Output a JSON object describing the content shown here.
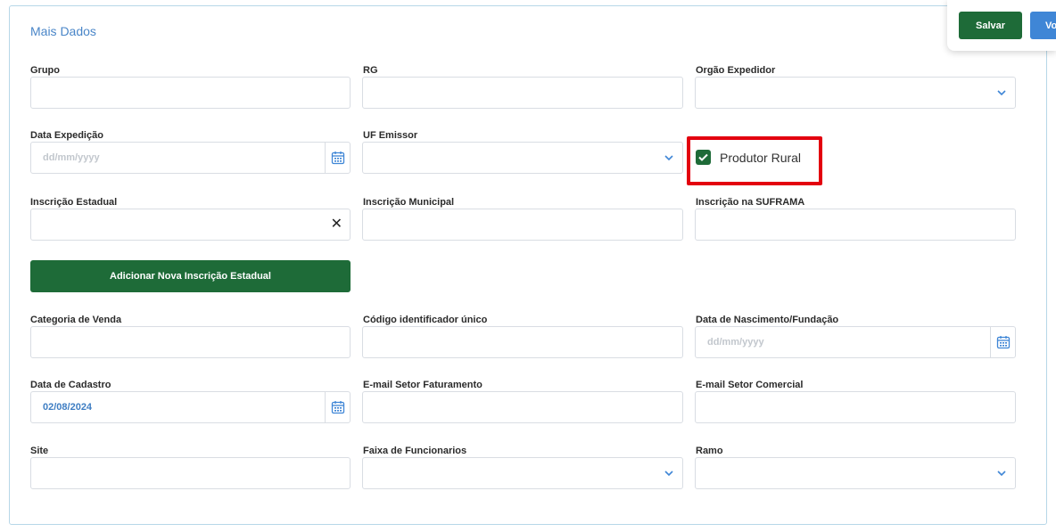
{
  "section": {
    "title": "Mais Dados"
  },
  "toolbar": {
    "save_label": "Salvar",
    "back_label": "Vo"
  },
  "fields": {
    "grupo": {
      "label": "Grupo",
      "value": ""
    },
    "rg": {
      "label": "RG",
      "value": ""
    },
    "orgao_expedidor": {
      "label": "Orgão Expedidor",
      "value": ""
    },
    "data_expedicao": {
      "label": "Data Expedição",
      "placeholder": "dd/mm/yyyy"
    },
    "uf_emissor": {
      "label": "UF Emissor",
      "value": ""
    },
    "produtor_rural": {
      "label": "Produtor Rural",
      "checked": true
    },
    "inscricao_estadual": {
      "label": "Inscrição Estadual",
      "value": ""
    },
    "inscricao_municipal": {
      "label": "Inscrição Municipal",
      "value": ""
    },
    "inscricao_suframa": {
      "label": "Inscrição na SUFRAMA",
      "value": ""
    },
    "categoria_venda": {
      "label": "Categoria de Venda",
      "value": ""
    },
    "codigo_identificador": {
      "label": "Código identificador único",
      "value": ""
    },
    "data_nascimento": {
      "label": "Data de Nascimento/Fundação",
      "placeholder": "dd/mm/yyyy"
    },
    "data_cadastro": {
      "label": "Data de Cadastro",
      "value": "02/08/2024"
    },
    "email_faturamento": {
      "label": "E-mail Setor Faturamento",
      "value": ""
    },
    "email_comercial": {
      "label": "E-mail Setor Comercial",
      "value": ""
    },
    "site": {
      "label": "Site",
      "value": ""
    },
    "faixa_funcionarios": {
      "label": "Faixa de Funcionarios",
      "value": ""
    },
    "ramo": {
      "label": "Ramo",
      "value": ""
    }
  },
  "actions": {
    "add_inscricao_label": "Adicionar Nova Inscrição Estadual"
  },
  "colors": {
    "primary_green": "#1e6b38",
    "accent_blue": "#3f86d6",
    "highlight_red": "#e3000f"
  },
  "icons": {
    "calendar": "calendar-icon",
    "chevron": "chevron-down-icon",
    "clear": "close-icon",
    "check": "check-icon"
  }
}
